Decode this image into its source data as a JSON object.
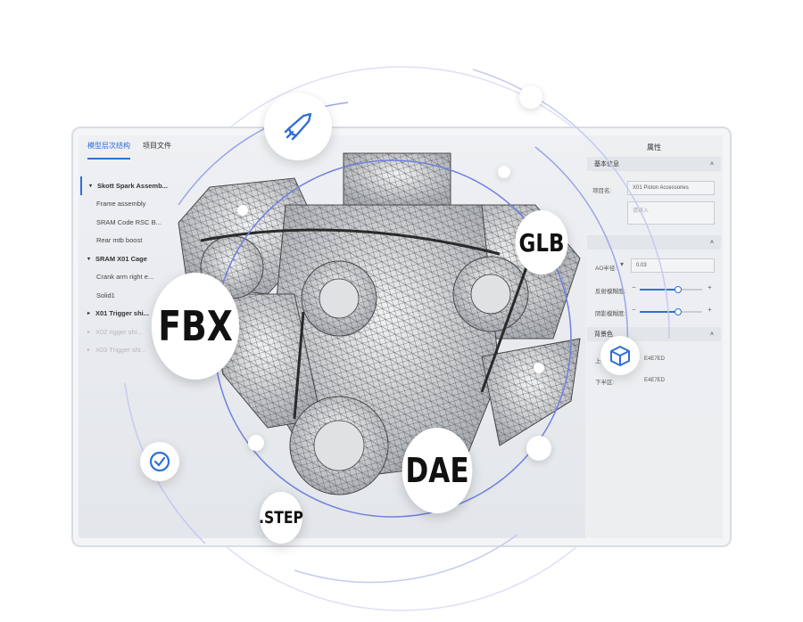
{
  "left_panel": {
    "tabs": [
      {
        "label": "模型层次结构"
      },
      {
        "label": "项目文件"
      }
    ],
    "tree": [
      {
        "label": "Skott Spark Assemb..."
      },
      {
        "label": "Frame assembly"
      },
      {
        "label": "SRAM Code RSC B..."
      },
      {
        "label": "Rear mtb boost"
      },
      {
        "label": "SRAM X01 Cage"
      },
      {
        "label": "Crank arm right e..."
      },
      {
        "label": "Solid1"
      },
      {
        "label": "X01 Trigger shi..."
      },
      {
        "label": "X02 rigger shi..."
      },
      {
        "label": "X03 Trigger shi..."
      }
    ]
  },
  "right_panel": {
    "title": "属性",
    "basic_section": "基本信息",
    "name_label": "项目名:",
    "name_value": "X01 Piston Accessories",
    "desc_placeholder": "请输入",
    "ao_label": "AO半径:",
    "ao_value": "0.03",
    "reflect_label": "反射模糊度:",
    "shadow_label": "阴影模糊度:",
    "bg_section": "背景色",
    "upper_label": "上半区:",
    "upper_value": "E4E7ED",
    "lower_label": "下半区:",
    "lower_value": "E4E7ED",
    "reflect_level": 0.6,
    "shadow_level": 0.6
  },
  "badges": {
    "fbx": "FBX",
    "glb": "GLB",
    "dae": "DAE",
    "step": ".STEP"
  },
  "icons": {
    "rocket": "rocket-icon",
    "clock": "clock-icon",
    "cube": "cube-icon"
  },
  "colors": {
    "accent": "#2f6fd6",
    "orbit": "#6f7fe0"
  }
}
